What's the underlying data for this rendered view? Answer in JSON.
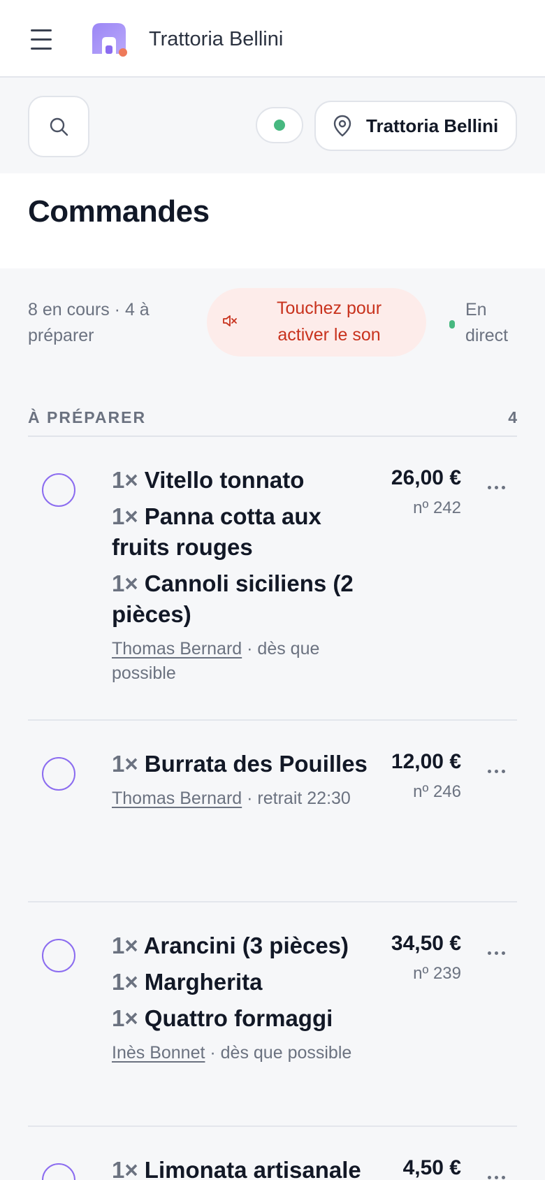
{
  "app": {
    "title": "Trattoria Bellini"
  },
  "toolbar": {
    "location_label": "Trattoria Bellini"
  },
  "page": {
    "title": "Commandes"
  },
  "summary": {
    "text": "8 en cours · 4 à préparer",
    "sound_button": "Touchez pour activer le son",
    "live_label": "En direct"
  },
  "section": {
    "title": "À PRÉPARER",
    "count": "4"
  },
  "orders": [
    {
      "items": [
        {
          "qty": "1×",
          "name": "Vitello tonnato"
        },
        {
          "qty": "1×",
          "name": "Panna cotta aux fruits rouges"
        },
        {
          "qty": "1×",
          "name": "Cannoli siciliens (2 pièces)"
        }
      ],
      "customer": "Thomas Bernard",
      "timing": " · dès que possible",
      "price": "26,00 €",
      "number": "nº 242"
    },
    {
      "items": [
        {
          "qty": "1×",
          "name": "Burrata des Pouilles"
        }
      ],
      "customer": "Thomas Bernard",
      "timing": " · retrait 22:30",
      "price": "12,00 €",
      "number": "nº 246"
    },
    {
      "items": [
        {
          "qty": "1×",
          "name": "Arancini (3 pièces)"
        },
        {
          "qty": "1×",
          "name": "Margherita"
        },
        {
          "qty": "1×",
          "name": "Quattro formaggi"
        }
      ],
      "customer": "Inès Bonnet",
      "timing": " · dès que possible",
      "price": "34,50 €",
      "number": "nº 239"
    },
    {
      "items": [
        {
          "qty": "1×",
          "name": "Limonata artisanale"
        }
      ],
      "customer": "",
      "timing": "",
      "price": "4,50 €",
      "number": ""
    }
  ],
  "colors": {
    "accent": "#8b6cf0",
    "live": "#47b880",
    "sound_bg": "#fdecea",
    "sound_text": "#c8321d"
  }
}
